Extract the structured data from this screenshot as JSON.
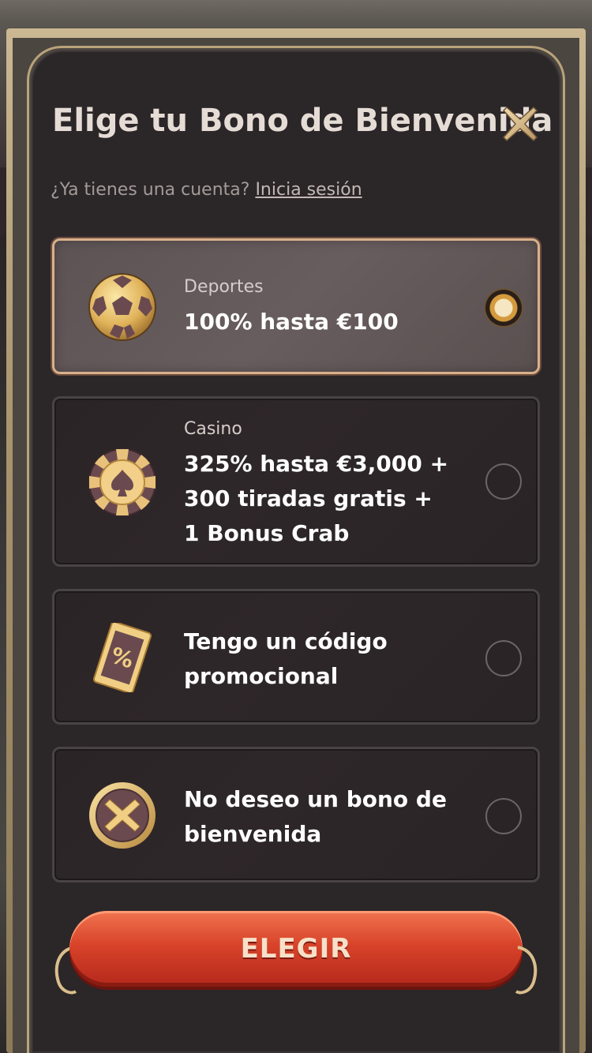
{
  "modal": {
    "title": "Elige tu Bono de Bienvenida",
    "subtitle_prefix": "¿Ya tienes una cuenta?",
    "login_link": "Inicia sesión",
    "close_icon": "close-x-icon"
  },
  "options": [
    {
      "category": "Deportes",
      "lines": [
        "100% hasta €100"
      ],
      "icon": "soccer-ball-icon",
      "selected": true
    },
    {
      "category": "Casino",
      "lines": [
        "325% hasta €3,000 +",
        "300 tiradas gratis +",
        "1 Bonus Crab"
      ],
      "icon": "casino-chip-icon",
      "selected": false
    },
    {
      "category": "",
      "lines": [
        "Tengo un código",
        "promocional"
      ],
      "icon": "promo-ticket-icon",
      "selected": false
    },
    {
      "category": "",
      "lines": [
        "No deseo un bono de",
        "bienvenida"
      ],
      "icon": "no-bonus-x-icon",
      "selected": false
    }
  ],
  "cta": {
    "label": "ELEGIR"
  },
  "colors": {
    "modal_bg": "#2b2628",
    "gold": "#d9b08c",
    "button_red": "#d8432a",
    "text": "#ffffff",
    "muted": "#a49a99"
  }
}
